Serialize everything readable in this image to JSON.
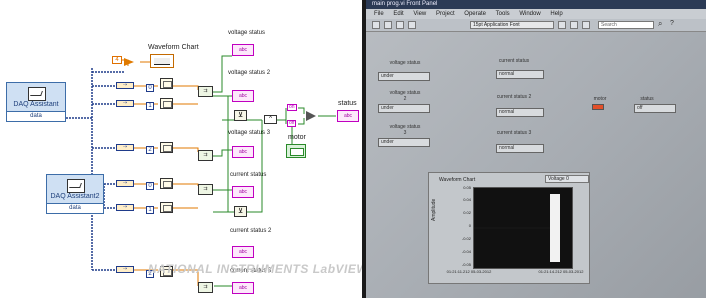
{
  "block_diagram": {
    "daq1": {
      "title": "DAQ Assistant",
      "output": "data"
    },
    "daq2": {
      "title": "DAQ Assistant2",
      "output": "data"
    },
    "const_value": "4",
    "waveform_chart_label": "Waveform Chart",
    "indices": [
      "0",
      "1",
      "2",
      "0",
      "1",
      "2"
    ],
    "indicators": [
      "voltage status",
      "voltage status 2",
      "voltage status 3",
      "current status",
      "current status 2",
      "current status 3"
    ],
    "on_label": "on",
    "off_label": "off",
    "motor_label": "motor",
    "status_label": "status",
    "and_symbol": "^",
    "abc": "abc",
    "watermark": "NATIONAL INSTRUMENTS LabVIEW Evaluation Software"
  },
  "front_panel": {
    "window_title": "main prog.vi Front Panel",
    "menus": [
      "File",
      "Edit",
      "View",
      "Project",
      "Operate",
      "Tools",
      "Window",
      "Help"
    ],
    "font_selector": "15pt Application Font",
    "search_placeholder": "Search",
    "voltage_labels": [
      "voltage status",
      "voltage status 2",
      "voltage status 3"
    ],
    "voltage_values": [
      "under",
      "under",
      "under"
    ],
    "current_labels": [
      "current status",
      "current status 2",
      "current status 3"
    ],
    "current_values": [
      "normal",
      "normal",
      "normal"
    ],
    "motor_label": "motor",
    "status_label": "status",
    "status_value": "off",
    "waveform_chart": {
      "title": "Waveform Chart",
      "legend": "Voltage 0",
      "ylabel": "Amplitude",
      "yticks": [
        "0.05",
        "0.04",
        "0.02",
        "0",
        "-0.02",
        "-0.04",
        "-0.05"
      ],
      "x_start": "01:21:11.212 05-03-2012",
      "x_end": "01:21:14.212 05-03-2012"
    }
  }
}
